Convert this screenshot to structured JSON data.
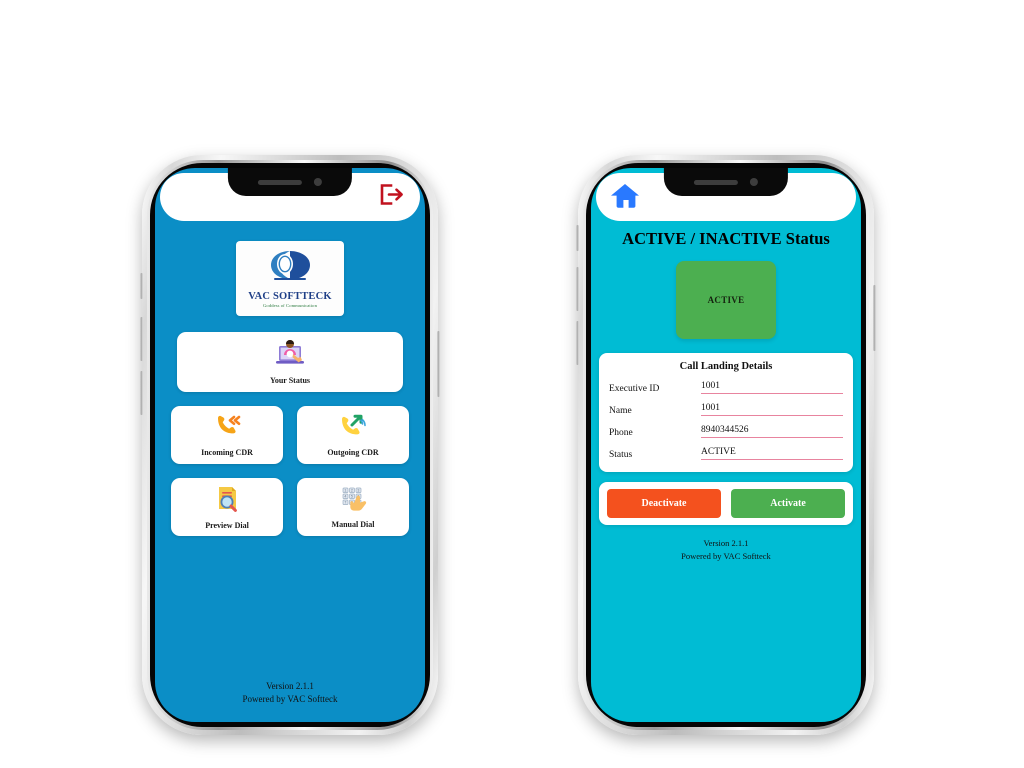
{
  "colors": {
    "left_screen_bg": "#0b8ec6",
    "right_screen_bg": "#00bcd4",
    "status_green": "#4caf50",
    "deactivate_orange": "#f4511e",
    "underline_pink": "#e8849f",
    "logo_blue": "#1f3f87",
    "home_icon_blue": "#2979ff",
    "logout_red": "#c1121f"
  },
  "left_phone": {
    "topbar": {
      "logout_icon": "logout-icon"
    },
    "logo": {
      "icon": "vac-softteck-logo-icon",
      "name": "VAC SOFTTECK",
      "tagline": "Goddess of Communication"
    },
    "status_tile": {
      "icon": "person-at-laptop-icon",
      "label": "Your Status"
    },
    "tiles": [
      {
        "icon": "incoming-call-icon",
        "label": "Incoming CDR"
      },
      {
        "icon": "outgoing-call-icon",
        "label": "Outgoing CDR"
      },
      {
        "icon": "document-magnifier-icon",
        "label": "Preview Dial"
      },
      {
        "icon": "keypad-hand-icon",
        "label": "Manual Dial"
      }
    ],
    "footer": {
      "version": "Version 2.1.1",
      "powered_by": "Powered by VAC Softteck"
    }
  },
  "right_phone": {
    "topbar": {
      "home_icon": "home-icon"
    },
    "page_title": "ACTIVE / INACTIVE Status",
    "status_box": {
      "label": "ACTIVE"
    },
    "details_card": {
      "title": "Call Landing Details",
      "fields": [
        {
          "label": "Executive ID",
          "value": "1001"
        },
        {
          "label": "Name",
          "value": "1001"
        },
        {
          "label": "Phone",
          "value": "8940344526"
        },
        {
          "label": "Status",
          "value": "ACTIVE"
        }
      ]
    },
    "actions": {
      "deactivate_label": "Deactivate",
      "activate_label": "Activate"
    },
    "footer": {
      "version": "Version 2.1.1",
      "powered_by": "Powered by VAC Softteck"
    }
  }
}
